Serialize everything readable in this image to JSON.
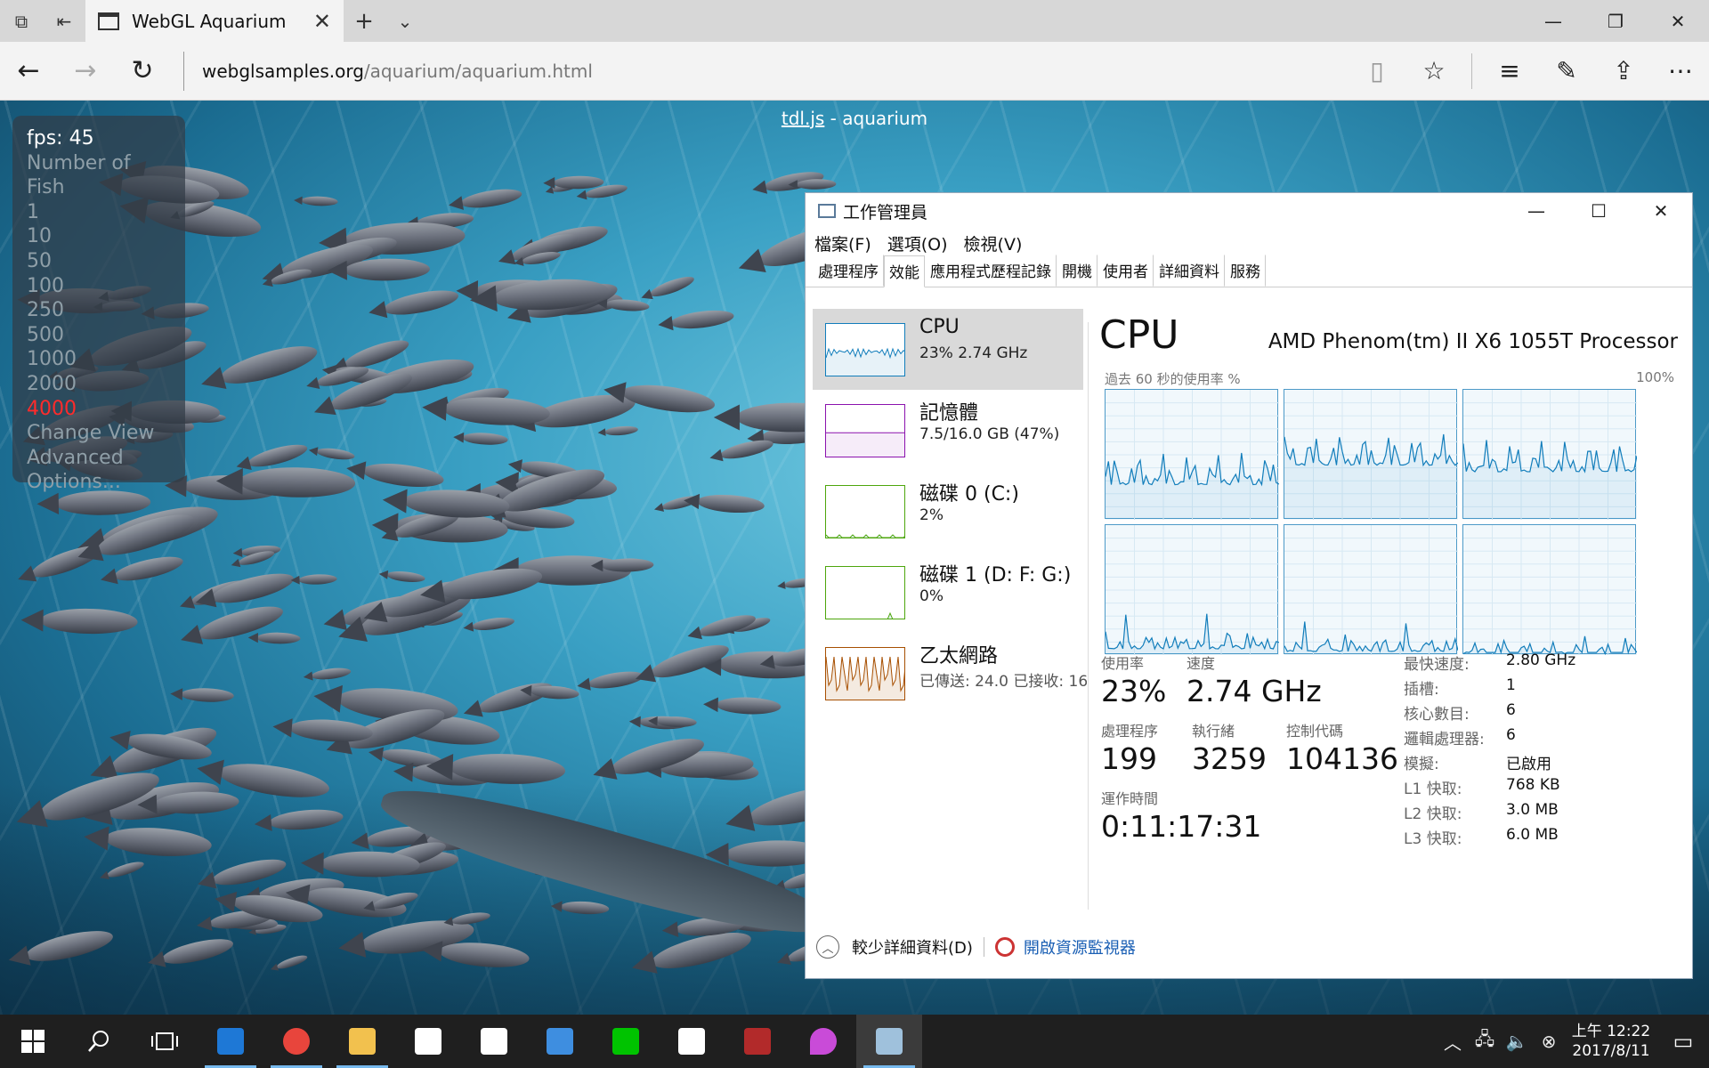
{
  "browser": {
    "tab_title": "WebGL Aquarium",
    "url_host": "webglsamples.org",
    "url_path": "/aquarium/aquarium.html"
  },
  "scene": {
    "title_link": "tdl.js",
    "title_rest": " - aquarium"
  },
  "fish_panel": {
    "fps": "fps: 45",
    "header": "Number of Fish",
    "options": [
      "1",
      "10",
      "50",
      "100",
      "250",
      "500",
      "1000",
      "2000",
      "4000"
    ],
    "selected": "4000",
    "change_view": "Change View",
    "advanced": "Advanced",
    "options_link": "Options..."
  },
  "taskmgr": {
    "title": "工作管理員",
    "menu": [
      "檔案(F)",
      "選項(O)",
      "檢視(V)"
    ],
    "tabs": [
      "處理程序",
      "效能",
      "應用程式歷程記錄",
      "開機",
      "使用者",
      "詳細資料",
      "服務"
    ],
    "active_tab": "效能",
    "resources": [
      {
        "name": "CPU",
        "value": "23%  2.74 GHz",
        "color": "#117dbb"
      },
      {
        "name": "記憶體",
        "value": "7.5/16.0 GB (47%)",
        "color": "#8b12ae"
      },
      {
        "name": "磁碟 0 (C:)",
        "value": "2%",
        "color": "#4da60c"
      },
      {
        "name": "磁碟 1 (D: F: G:)",
        "value": "0%",
        "color": "#4da60c"
      },
      {
        "name": "乙太網路",
        "value": "已傳送: 24.0  已接收: 16",
        "color": "#a74f01"
      }
    ],
    "cpu_label": "CPU",
    "cpu_model": "AMD Phenom(tm) II X6 1055T Processor",
    "graph_caption": "過去 60 秒的使用率 %",
    "graph_max": "100%",
    "stats": {
      "usage_label": "使用率",
      "usage_value": "23%",
      "speed_label": "速度",
      "speed_value": "2.74 GHz",
      "proc_label": "處理程序",
      "proc_value": "199",
      "threads_label": "執行緒",
      "threads_value": "3259",
      "handles_label": "控制代碼",
      "handles_value": "104136",
      "uptime_label": "運作時間",
      "uptime_value": "0:11:17:31"
    },
    "specs": [
      {
        "k": "最快速度:",
        "v": "2.80 GHz"
      },
      {
        "k": "插槽:",
        "v": "1"
      },
      {
        "k": "核心數目:",
        "v": "6"
      },
      {
        "k": "邏輯處理器:",
        "v": "6"
      },
      {
        "k": "模擬:",
        "v": "已啟用"
      },
      {
        "k": "L1 快取:",
        "v": "768 KB"
      },
      {
        "k": "L2 快取:",
        "v": "3.0 MB"
      },
      {
        "k": "L3 快取:",
        "v": "6.0 MB"
      }
    ],
    "fewer_details": "較少詳細資料(D)",
    "open_monitor": "開啟資源監視器"
  },
  "taskbar": {
    "time": "上午 12:22",
    "date": "2017/8/11",
    "apps": [
      {
        "icon": "edge-icon",
        "color": "#1e78d6",
        "running": true
      },
      {
        "icon": "chrome-icon",
        "color": "#e8453c",
        "running": true
      },
      {
        "icon": "file-explorer-icon",
        "color": "#f2c14e",
        "running": true
      },
      {
        "icon": "store-icon",
        "color": "#ffffff",
        "running": false
      },
      {
        "icon": "mail-icon",
        "color": "#ffffff",
        "running": false
      },
      {
        "icon": "feedback-icon",
        "color": "#3e8ee0",
        "running": false
      },
      {
        "icon": "line-icon",
        "color": "#00c300",
        "running": false
      },
      {
        "icon": "calculator-icon",
        "color": "#ffffff",
        "running": false
      },
      {
        "icon": "ninja-icon",
        "color": "#b22a2a",
        "running": false
      },
      {
        "icon": "maps-icon",
        "color": "#c94bd8",
        "running": false
      },
      {
        "icon": "task-manager-icon",
        "color": "#9fc1dc",
        "running": true
      }
    ]
  }
}
